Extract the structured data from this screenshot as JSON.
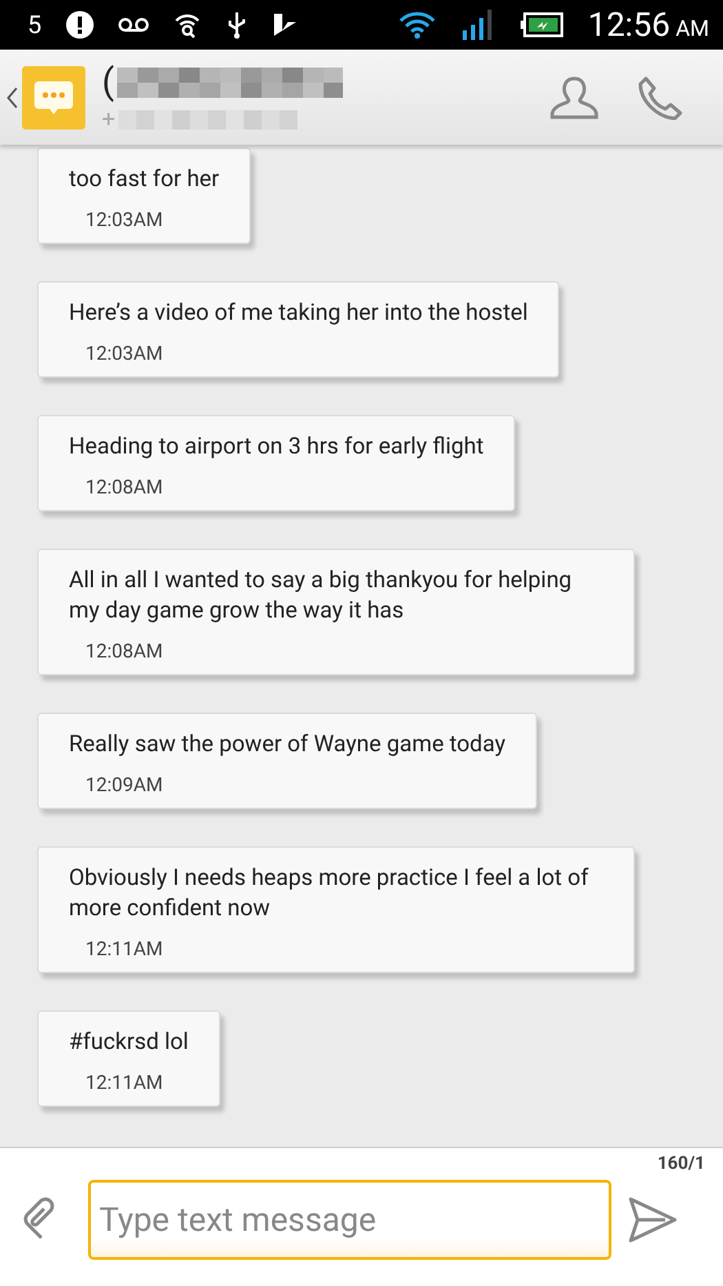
{
  "status_bar": {
    "notification_count": "5",
    "time": "12:56",
    "meridiem": "AM"
  },
  "header": {
    "name_visible": "(",
    "number_visible": "+"
  },
  "messages": [
    {
      "text": "too fast for her",
      "time": "12:03AM"
    },
    {
      "text": "Here’s a video of me taking her into the hostel",
      "time": "12:03AM"
    },
    {
      "text": "Heading to airport on 3 hrs for early flight",
      "time": "12:08AM"
    },
    {
      "text": "All in all I wanted to say a big thankyou for helping my day game grow the way it has",
      "time": "12:08AM"
    },
    {
      "text": "Really saw the power of Wayne game today",
      "time": "12:09AM"
    },
    {
      "text": "Obviously I needs heaps more practice I feel a lot of more confident now",
      "time": "12:11AM"
    },
    {
      "text": "#fuckrsd lol",
      "time": "12:11AM"
    }
  ],
  "composer": {
    "counter": "160/1",
    "placeholder": "Type text message"
  }
}
